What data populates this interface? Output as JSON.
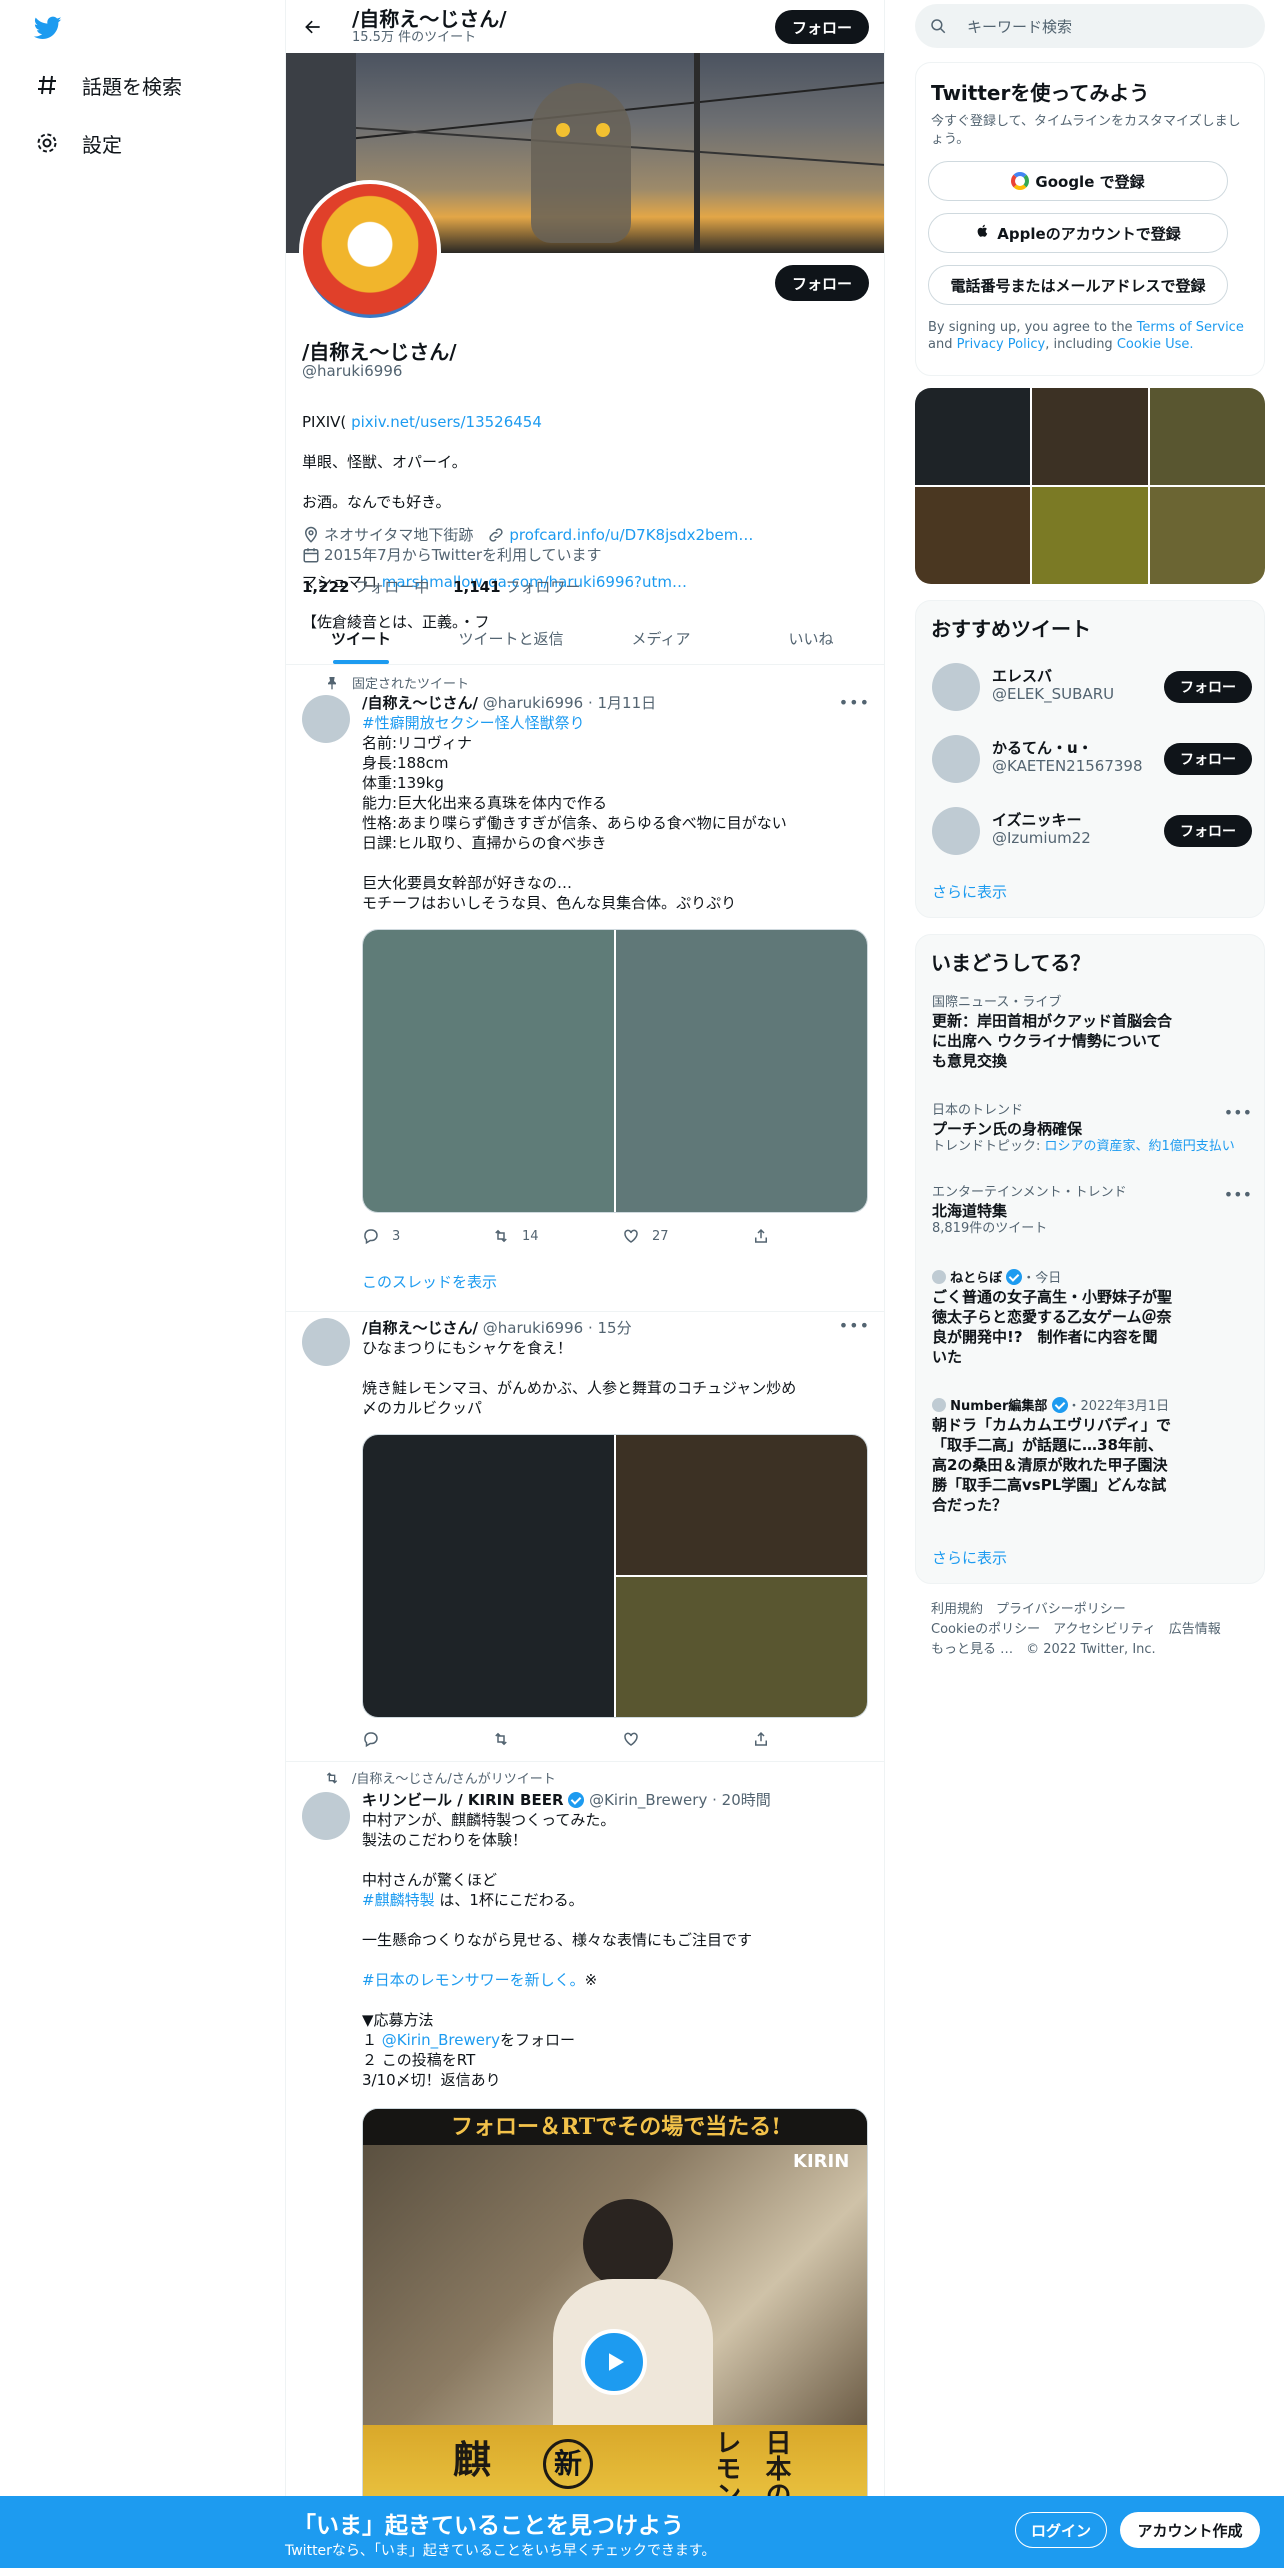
{
  "nav": {
    "explore_label": "話題を検索",
    "settings_label": "設定"
  },
  "topbar": {
    "name": "/自称え～じさん/",
    "tweet_count": "15.5万 件のツイート",
    "follow_label": "フォロー"
  },
  "profile": {
    "name": "/自称え～じさん/",
    "handle": "@haruki6996",
    "follow_label": "フォロー",
    "bio_pixiv_prefix": "PIXIV(",
    "bio_pixiv_link": "pixiv.net/users/13526454",
    "bio_line2": "単眼、怪獣、オパーイ。",
    "bio_line3": "お酒。なんでも好き。",
    "bio_marshmallow_prefix": "マシュマロ",
    "bio_marshmallow_link": "marshmallow-qa.com/haruki6996?utm…",
    "bio_line6": "【佐倉綾音とは、正義。・フ",
    "location": "ネオサイタマ地下街跡",
    "website": "profcard.info/u/D7K8jsdx2bem…",
    "joined": "2015年7月からTwitterを利用しています",
    "following_count": "1,222",
    "following_label": "フォロー中",
    "followers_count": "1,141",
    "followers_label": "フォロワー"
  },
  "tabs": [
    "ツイート",
    "ツイートと返信",
    "メディア",
    "いいね"
  ],
  "tweets": [
    {
      "context": "固定されたツイート",
      "name": "/自称え～じさん/",
      "handle": "@haruki6996",
      "time": "1月11日",
      "hashtag": "#性癖開放セクシー怪人怪獣祭り",
      "lines": [
        "名前:リコヴィナ",
        "身長:188cm",
        "体重:139kg",
        "能力:巨大化出来る真珠を体内で作る",
        "性格:あまり喋らず働きすぎが信条、あらゆる食べ物に目がない",
        "日課:ヒル取り、直掃からの食べ歩き",
        "",
        "巨大化要員女幹部が好きなの…",
        "モチーフはおいしそうな貝、色んな貝集合体。ぷりぷり"
      ],
      "replies": "3",
      "retweets": "14",
      "likes": "27",
      "thread_link": "このスレッドを表示"
    },
    {
      "name": "/自称え～じさん/",
      "handle": "@haruki6996",
      "time": "15分",
      "lines": [
        "ひなまつりにもシャケを食え！",
        "",
        "焼き鮭レモンマヨ、がんめかぶ、人参と舞茸のコチュジャン炒め",
        "〆のカルビクッパ"
      ]
    },
    {
      "context": "/自称え～じさん/さんがリツイート",
      "name": "キリンビール / KIRIN BEER",
      "handle": "@Kirin_Brewery",
      "time": "20時間",
      "line1": "中村アンが、麒麟特製つくってみた。",
      "line2": "製法のこだわりを体験！",
      "line4": "中村さんが驚くほど",
      "hashtag1": "#麒麟特製",
      "line5_suffix": " は、1杯にこだわる。",
      "line7": "一生懸命つくりながら見せる、様々な表情にもご注目です",
      "hashtag2": "#日本のレモンサワーを新しく。",
      "hashtag2_suffix": "※",
      "line11": "▼応募方法",
      "line12_prefix": "１",
      "line12_link": "@Kirin_Brewery",
      "line12_suffix": "をフォロー",
      "line13": "２ この投稿をRT",
      "line14": "3/10〆切！返信あり",
      "ad_banner": "フォロー＆RTでその場で当たる!",
      "ad_brand": "KIRIN",
      "ad_tail_1": "麒",
      "ad_tail_2": "新",
      "ad_tail_3": "レモン",
      "ad_tail_4": "日本の"
    }
  ],
  "right": {
    "search_placeholder": "キーワード検索",
    "signup_title": "Twitterを使ってみよう",
    "signup_sub": "今すぐ登録して、タイムラインをカスタマイズしましょう。",
    "google_btn": "Google で登録",
    "apple_btn": "Appleのアカウントで登録",
    "phone_btn": "電話番号またはメールアドレスで登録",
    "terms_prefix": "By signing up, you agree to the",
    "terms_link": "Terms of Service",
    "terms_and": "and",
    "privacy_link": "Privacy Policy",
    "terms_including": ", including",
    "cookie_link": "Cookie Use.",
    "rec_title": "おすすめツイート",
    "recs": [
      {
        "name": "エレスバ",
        "handle": "@ELEK_SUBARU"
      },
      {
        "name": "かるてん・u・",
        "handle": "@KAETEN21567398"
      },
      {
        "name": "イズニッキー",
        "handle": "@Izumium22"
      }
    ],
    "rec_follow": "フォロー",
    "show_more": "さらに表示",
    "trends_title": "いまどうしてる？",
    "trends": [
      {
        "cat": "国際ニュース・ライブ",
        "title": "更新：岸田首相がクアッド首脳会合に出席へ ウクライナ情勢についても意見交換"
      },
      {
        "cat": "日本のトレンド",
        "title": "プーチン氏の身柄確保",
        "sub_prefix": "トレンドトピック:",
        "sub_link": "ロシアの資産家、約1億円支払い"
      },
      {
        "cat": "エンターテインメント・トレンド",
        "title": "北海道特集",
        "sub": "8,819件のツイート"
      },
      {
        "src": "ねとらぼ",
        "time": "・今日",
        "title": "ごく普通の女子高生・小野妹子が聖徳太子らと恋愛する乙女ゲーム＠奈良が開発中!?　制作者に内容を聞いた"
      },
      {
        "src": "Number編集部",
        "time": "・2022年3月1日",
        "title": "朝ドラ「カムカムエヴリバディ」で「取手二高」が話題に…38年前、高2の桑田＆清原が敗れた甲子園決勝「取手二高vsPL学園」どんな試合だった？"
      }
    ],
    "trends_more": "さらに表示",
    "footer_line1": "利用規約　プライバシーポリシー",
    "footer_line2": "Cookieのポリシー　アクセシビリティ　広告情報",
    "footer_line3": "もっと見る …　© 2022 Twitter, Inc."
  },
  "bottom": {
    "title": "「いま」起きていることを見つけよう",
    "sub": "Twitterなら、「いま」起きていることをいち早くチェックできます。",
    "login": "ログイン",
    "signup": "アカウント作成"
  },
  "colors": {
    "accent": "#1d9bf0",
    "text": "#0f1419",
    "muted": "#536471"
  }
}
